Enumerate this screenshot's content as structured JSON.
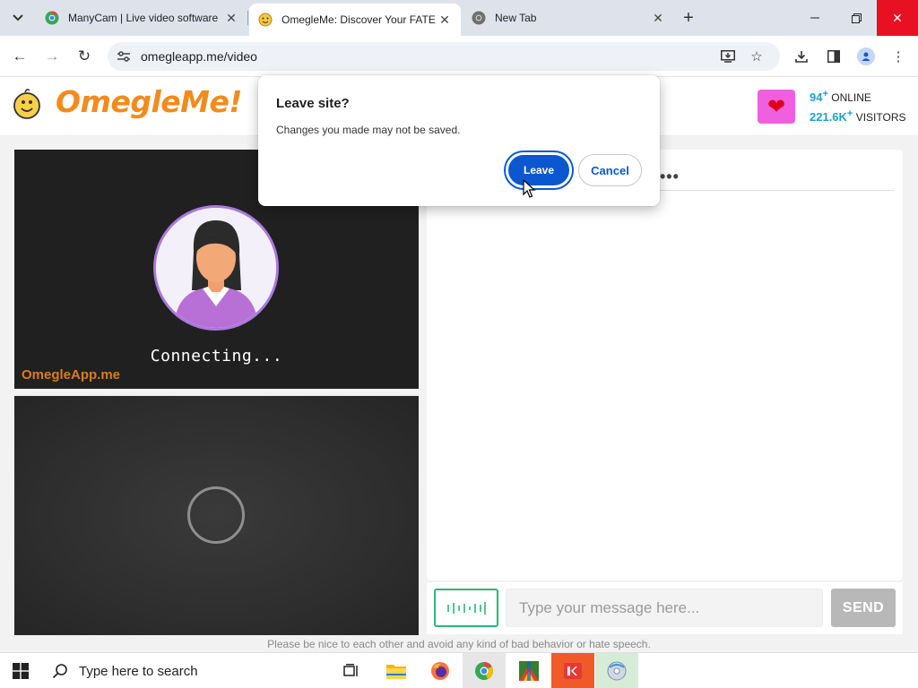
{
  "browser": {
    "tabs": [
      {
        "title": "ManyCam | Live video software",
        "active": false
      },
      {
        "title": "OmegleMe: Discover Your FATE",
        "active": true
      },
      {
        "title": "New Tab",
        "active": false
      }
    ],
    "url": "omegleapp.me/video"
  },
  "site": {
    "logo": "OmegleMe!",
    "online_count": "94",
    "online_label": "ONLINE",
    "visitors_count": "221.6K",
    "visitors_label": "VISITORS",
    "plus": "+"
  },
  "video": {
    "status": "Connecting...",
    "watermark": "OmegleApp.me"
  },
  "chat": {
    "placeholder": "Type your message here...",
    "send_label": "SEND",
    "typing_indicator": "•••"
  },
  "footer": {
    "note": "Please be nice to each other and avoid any kind of bad behavior or hate speech."
  },
  "dialog": {
    "title": "Leave site?",
    "message": "Changes you made may not be saved.",
    "leave_label": "Leave",
    "cancel_label": "Cancel"
  },
  "taskbar": {
    "search_text": "Type here to search"
  },
  "colors": {
    "brand_orange": "#f28b1d",
    "accent_blue": "#0b57d0",
    "stat_blue": "#1aa3c8",
    "mic_green": "#2fb37a"
  }
}
